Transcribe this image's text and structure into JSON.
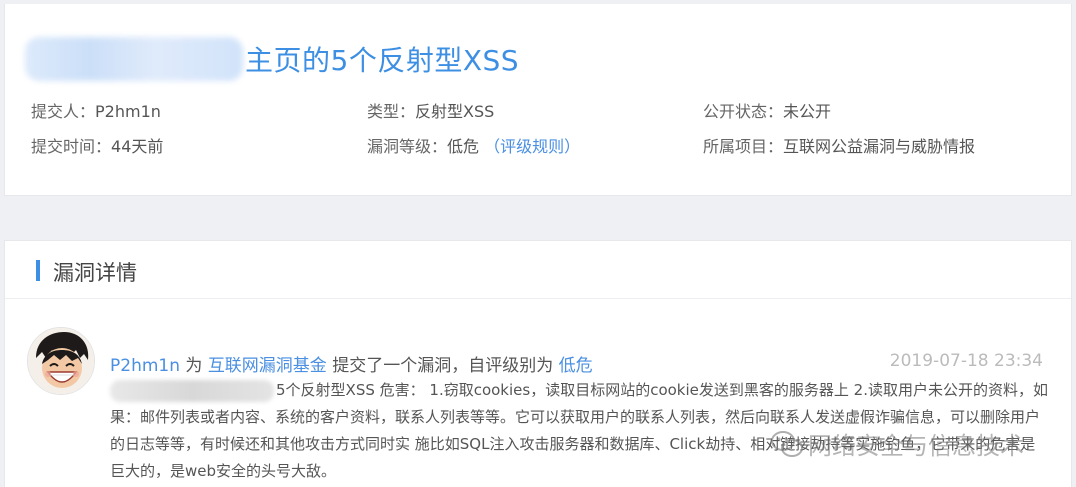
{
  "header": {
    "title": "主页的5个反射型XSS"
  },
  "meta": {
    "submitter_label": "提交人：",
    "submitter_value": "P2hm1n",
    "type_label": "类型：",
    "type_value": "反射型XSS",
    "status_label": "公开状态：",
    "status_value": "未公开",
    "time_label": "提交时间：",
    "time_value": "44天前",
    "level_label": "漏洞等级：",
    "level_value": "低危",
    "level_rule_link": "（评级规则）",
    "project_label": "所属项目：",
    "project_value": "互联网公益漏洞与威胁情报"
  },
  "detail": {
    "section_title": "漏洞详情",
    "author": "P2hm1n",
    "for_text": "为",
    "fund_link": "互联网漏洞基金",
    "action_text": "提交了一个漏洞，自评级别为",
    "self_level": "低危",
    "date": "2019-07-18 23:34",
    "body_text": "5个反射型XSS 危害： 1.窃取cookies，读取目标网站的cookie发送到黑客的服务器上 2.读取用户未公开的资料，如果：邮件列表或者内容、系统的客户资料，联系人列表等等。它可以获取用户的联系人列表，然后向联系人发送虚假诈骗信息，可以删除用户的日志等等，有时候还和其他攻击方式同时实 施比如SQL注入攻击服务器和数据库、Click劫持、相对链接劫持等实施钓鱼，它带来的危害是巨大的，是web安全的头号大敌。"
  },
  "watermark": {
    "text": "网络安全与信息技术",
    "icon": "wechat-icon"
  },
  "colors": {
    "accent": "#3d8fe4",
    "link": "#4a8fe2",
    "date": "#bbbbbb",
    "background": "#eef0f3"
  }
}
